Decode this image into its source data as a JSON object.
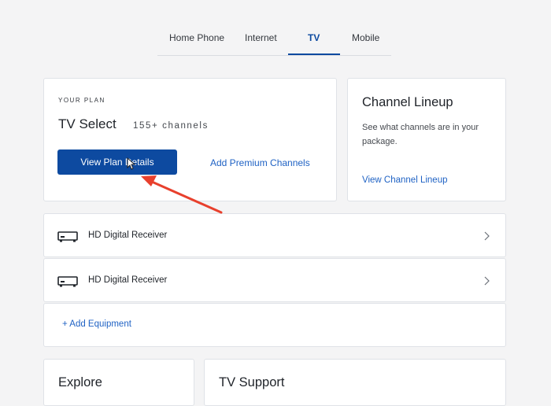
{
  "tabs": [
    {
      "label": "Home Phone",
      "active": false
    },
    {
      "label": "Internet",
      "active": false
    },
    {
      "label": "TV",
      "active": true
    },
    {
      "label": "Mobile",
      "active": false
    }
  ],
  "plan": {
    "eyebrow": "YOUR PLAN",
    "name": "TV Select",
    "channels": "155+ channels",
    "primary_button": "View Plan Details",
    "premium_link": "Add Premium Channels"
  },
  "lineup": {
    "title": "Channel Lineup",
    "description": "See what channels are in your package.",
    "link": "View Channel Lineup"
  },
  "equipment": {
    "items": [
      {
        "label": "HD Digital Receiver",
        "icon": "receiver-icon"
      },
      {
        "label": "HD Digital Receiver",
        "icon": "receiver-icon"
      }
    ],
    "add_link": "+ Add Equipment"
  },
  "bottom": {
    "explore_title": "Explore",
    "support_title": "TV Support"
  },
  "colors": {
    "brand_blue": "#0d4aa0",
    "link_blue": "#1f62c4",
    "annotation_red": "#e8402d",
    "page_bg": "#f4f4f5"
  }
}
